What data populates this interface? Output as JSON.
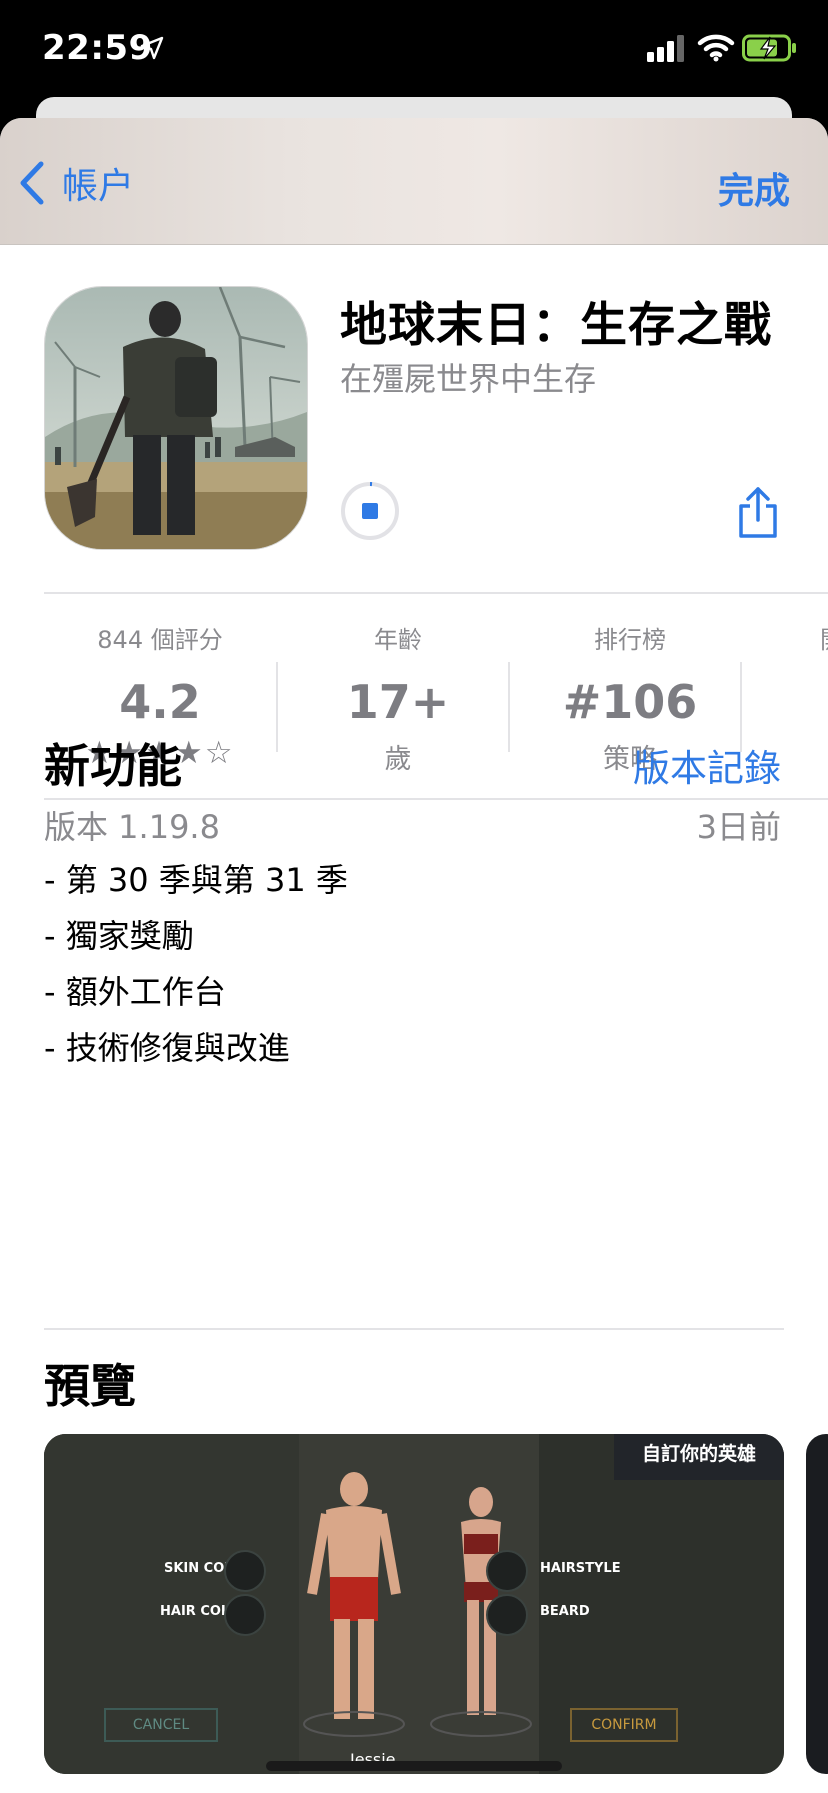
{
  "status_bar": {
    "time": "22:59"
  },
  "nav": {
    "back_label": "帳户",
    "done_label": "完成"
  },
  "app": {
    "title": "地球末日：生存之戰",
    "subtitle": "在殭屍世界中生存"
  },
  "stats": [
    {
      "label": "844 個評分",
      "value": "4.2",
      "rating_stars": 4,
      "rating_max": 5
    },
    {
      "label": "年齡",
      "value": "17+",
      "sub": "歲"
    },
    {
      "label": "排行榜",
      "value": "#106",
      "sub": "策略"
    },
    {
      "label": "開",
      "value": "",
      "sub": ""
    }
  ],
  "whats_new": {
    "title": "新功能",
    "history_link": "版本記錄",
    "version": "版本 1.19.8",
    "date_ago": "3日前",
    "notes": [
      "- 第 30 季與第 31 季",
      "- 獨家獎勵",
      "- 額外工作台",
      "- 技術修復與改進"
    ]
  },
  "preview": {
    "title": "預覽",
    "banner": "自訂你的英雄",
    "left_options": [
      "SKIN COLOR",
      "HAIR COLOR"
    ],
    "right_options": [
      "HAIRSTYLE",
      "BEARD"
    ],
    "cancel_label": "CANCEL",
    "confirm_label": "CONFIRM",
    "character_name": "Jessie"
  },
  "colors": {
    "accent": "#2f7ae5",
    "secondary_text": "#8a8a8e"
  }
}
